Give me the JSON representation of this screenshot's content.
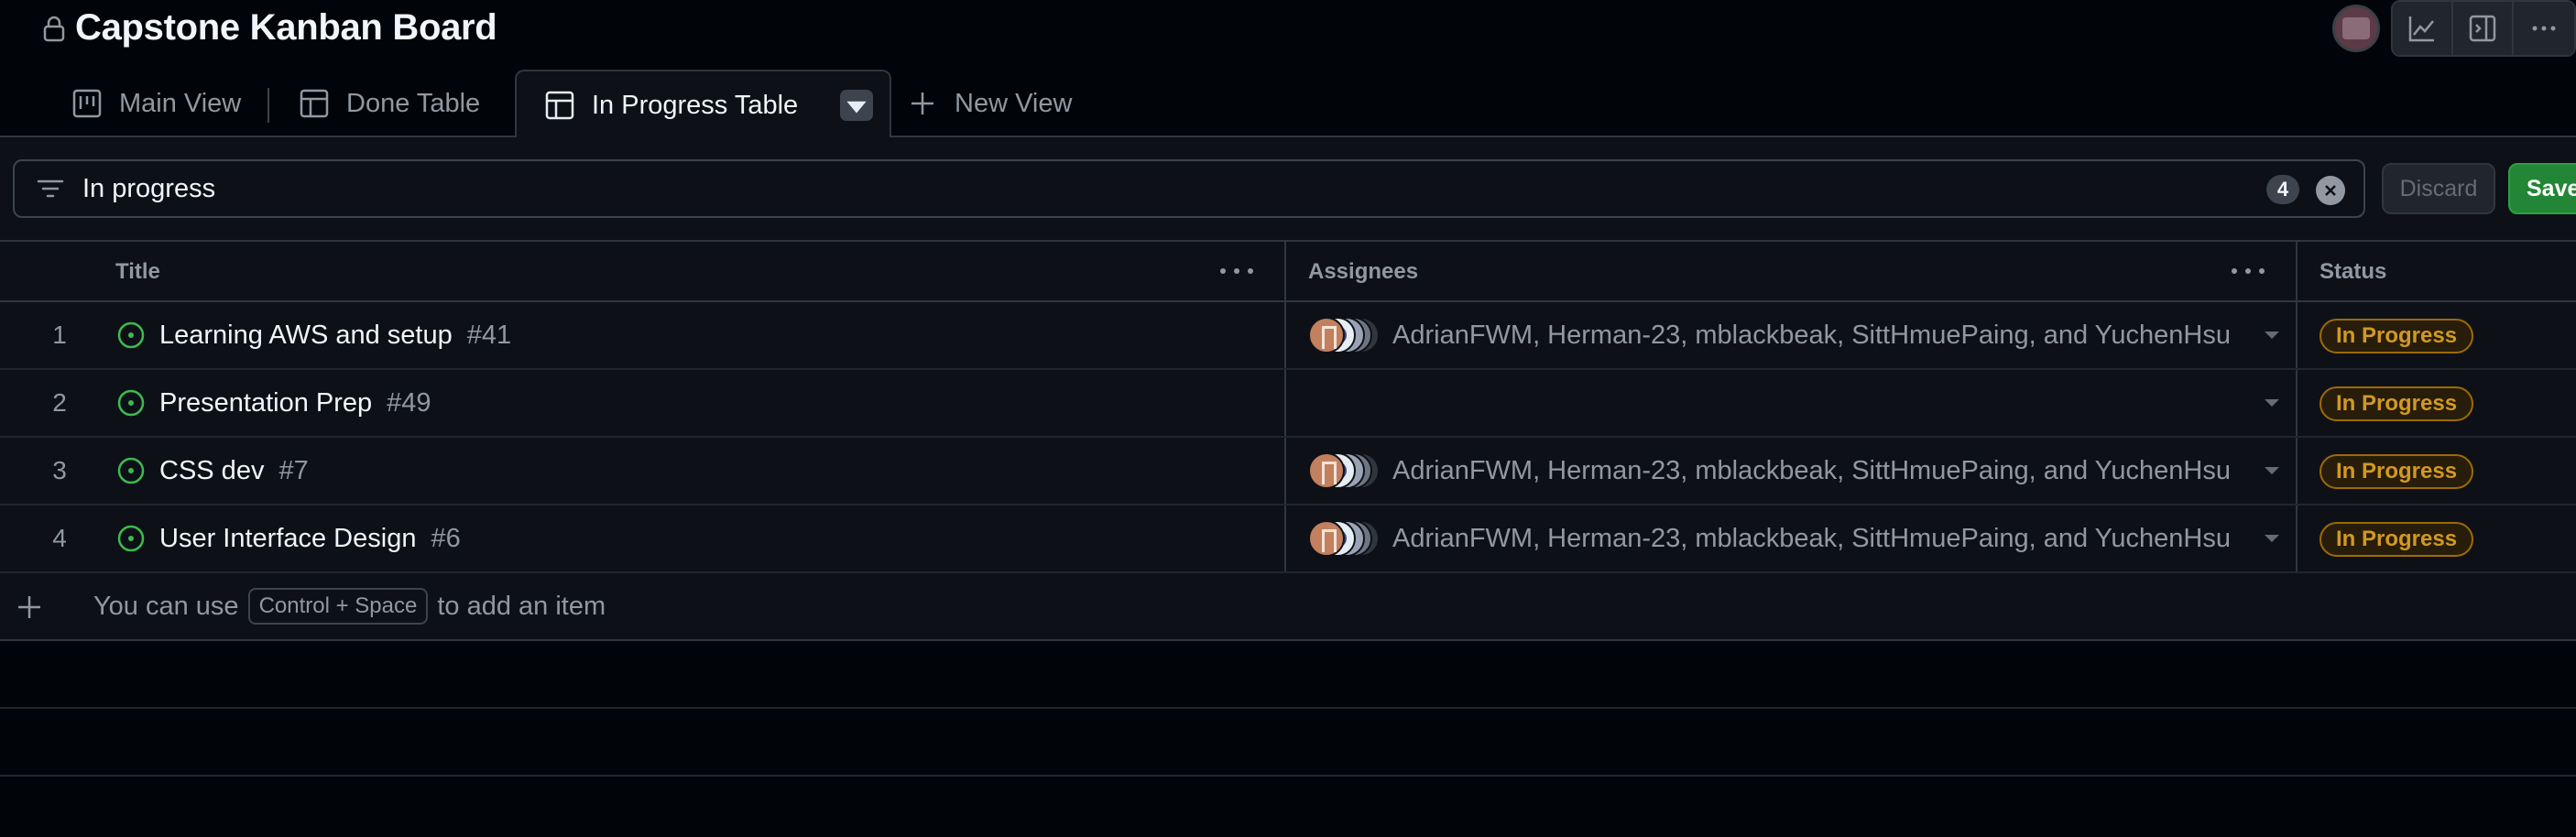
{
  "project": {
    "title": "Capstone Kanban Board"
  },
  "header_buttons": [
    "insights-icon",
    "side-panel-icon",
    "more-options-icon"
  ],
  "tabs": [
    {
      "label": "Main View",
      "icon": "board-icon"
    },
    {
      "label": "Done Table",
      "icon": "table-icon"
    },
    {
      "label": "In Progress Table",
      "icon": "table-icon",
      "active": true
    },
    {
      "label": "New View",
      "icon": "plus-icon"
    }
  ],
  "filter": {
    "value": "In progress",
    "count": "4",
    "discard_label": "Discard",
    "save_label": "Save"
  },
  "columns": {
    "title": "Title",
    "assignees": "Assignees",
    "status": "Status"
  },
  "rows": [
    {
      "num": "1",
      "title": "Learning AWS and setup",
      "issue": "#41",
      "assignees": "AdrianFWM, Herman-23, mblackbeak, SittHmuePaing, and YuchenHsu",
      "status": "In Progress"
    },
    {
      "num": "2",
      "title": "Presentation Prep",
      "issue": "#49",
      "assignees": "",
      "status": "In Progress"
    },
    {
      "num": "3",
      "title": "CSS dev",
      "issue": "#7",
      "assignees": "AdrianFWM, Herman-23, mblackbeak, SittHmuePaing, and YuchenHsu",
      "status": "In Progress"
    },
    {
      "num": "4",
      "title": "User Interface Design",
      "issue": "#6",
      "assignees": "AdrianFWM, Herman-23, mblackbeak, SittHmuePaing, and YuchenHsu",
      "status": "In Progress"
    }
  ],
  "add_item": {
    "prefix": "You can use",
    "shortcut": "Control + Space",
    "suffix": "to add an item"
  },
  "colors": {
    "accent_green": "#3fb950",
    "status_text": "#d29922",
    "save_bg": "#238636"
  }
}
